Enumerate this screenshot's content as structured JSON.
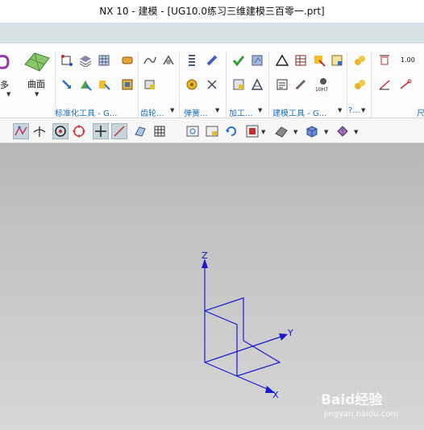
{
  "window": {
    "title": "NX 10 - 建模 - [UG10.0练习三维建模三百零一.prt]"
  },
  "ribbon": {
    "labels": {
      "more": "多",
      "surface": "曲面"
    },
    "groups": [
      {
        "label": "标准化工具 - G..."
      },
      {
        "label": "齿轮..."
      },
      {
        "label": "弹簧..."
      },
      {
        "label": "加工..."
      },
      {
        "label": "建模工具 - G..."
      },
      {
        "label": "?..."
      },
      {
        "label": "尺"
      }
    ],
    "value_100": "1.00",
    "hole_label": "10H7"
  },
  "viewport": {
    "axes": {
      "x": "X",
      "y": "Y",
      "z": "Z"
    }
  },
  "watermark": {
    "main": "Baid经验",
    "sub": "jingyan.baidu.com"
  },
  "colors": {
    "axis": "#1a1acc",
    "accent": "#1f6fb5"
  }
}
